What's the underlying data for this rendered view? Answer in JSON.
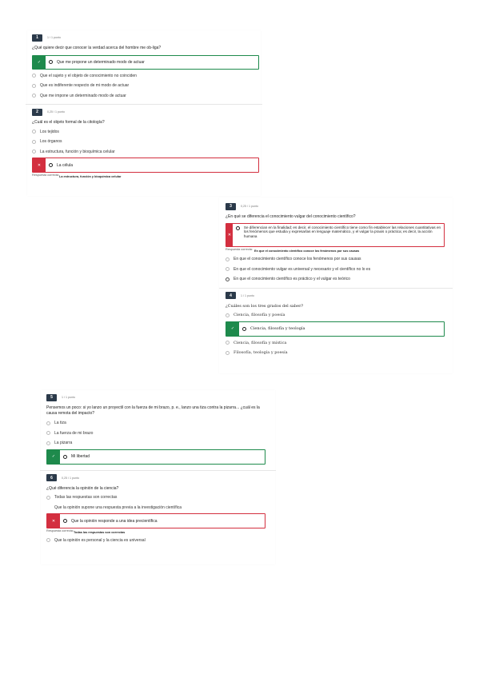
{
  "page1": {
    "q1": {
      "number": "1",
      "score": "1 / 1 punto",
      "question": "¿Qué quiere decir que conocer la verdad acerca del hombre me ob-liga?",
      "selected": {
        "mark": "✓",
        "text": "Que me propone un determinado modo de actuar"
      },
      "options": [
        "Que el sujeto y el objeto de conocimiento no coinciden",
        "Que es indiferente respecto de mi modo de actuar",
        "Que me impone un determinado modo de actuar"
      ]
    },
    "q2": {
      "number": "2",
      "score": "0,25 / 1 punto",
      "question": "¿Cuál es el objeto formal de la citología?",
      "options": [
        "Los tejidos",
        "Los órganos",
        "La estructura, función y bioquímica celular"
      ],
      "selected": {
        "mark": "✕",
        "text": "La célula"
      },
      "correct_label": "Respuesta correcta:",
      "correct_value": "La estructura, función y bioquímica celular"
    }
  },
  "page2": {
    "q3": {
      "number": "3",
      "score": "0,25 / 1 punto",
      "question": "¿En qué se diferencia el conocimiento vulgar del conocimiento científico?",
      "selected": {
        "mark": "✕",
        "text": "Se diferencian en la finalidad; es decir, el conocimiento científico tiene como fin establecer las relaciones cuantitativas en los fenómenos que estudia y expresarlas en lenguaje matemático, y el vulgar la praxis o práctica; es decir, la acción humana"
      },
      "correct_label": "Respuesta correcta:",
      "correct_value": "En que el conocimiento científico conoce los fenómenos por sus causas",
      "options": [
        "En que el conocimiento científico conoce los fenómenos por sus causas",
        "En que el conocimiento vulgar es universal y necesario y el científico no lo es",
        "En que el conocimiento científico es práctico y el vulgar es teórico"
      ]
    },
    "q4": {
      "number": "4",
      "score": "1 / 1 punto",
      "question": "¿Cuáles son los tres grados del saber?",
      "options_before": [
        "Ciencia, filosofía y poesía"
      ],
      "selected": {
        "mark": "✓",
        "text": "Ciencia, filosofía y teología"
      },
      "options_after": [
        "Ciencia, filosofía y mística",
        "Filosofía, teología y poesía"
      ]
    }
  },
  "page3": {
    "q5": {
      "number": "5",
      "score": "1 / 1 punto",
      "question": "Pensemos un poco: si yo lanzo un proyectil con la fuerza de mi brazo, p. e., lanzo una tiza contra la pizarra... ¿cuál es la causa remota del impacto?",
      "options": [
        "La tiza",
        "La fuerza de mi brazo",
        "La pizarra"
      ],
      "selected": {
        "mark": "✓",
        "text": "Mi libertad"
      }
    },
    "q6": {
      "number": "6",
      "score": "0,25 / 1 punto",
      "question": "¿Qué diferencia la opinión de la ciencia?",
      "options_before": [
        "Todas las respuestas son correctas",
        "Que la opinión supone una respuesta previa a la investigación científica"
      ],
      "selected": {
        "mark": "✕",
        "text": "Que la opinión responde a una idea precientífica"
      },
      "correct_label": "Respuesta correcta:",
      "correct_value": "Todas las respuestas son correctas",
      "options_after": [
        "Que la opinión es personal y la ciencia es universal"
      ]
    }
  },
  "colors": {
    "correct": "#1e8a4c",
    "incorrect": "#d32f3f",
    "number_bg": "#2b3a4a"
  }
}
